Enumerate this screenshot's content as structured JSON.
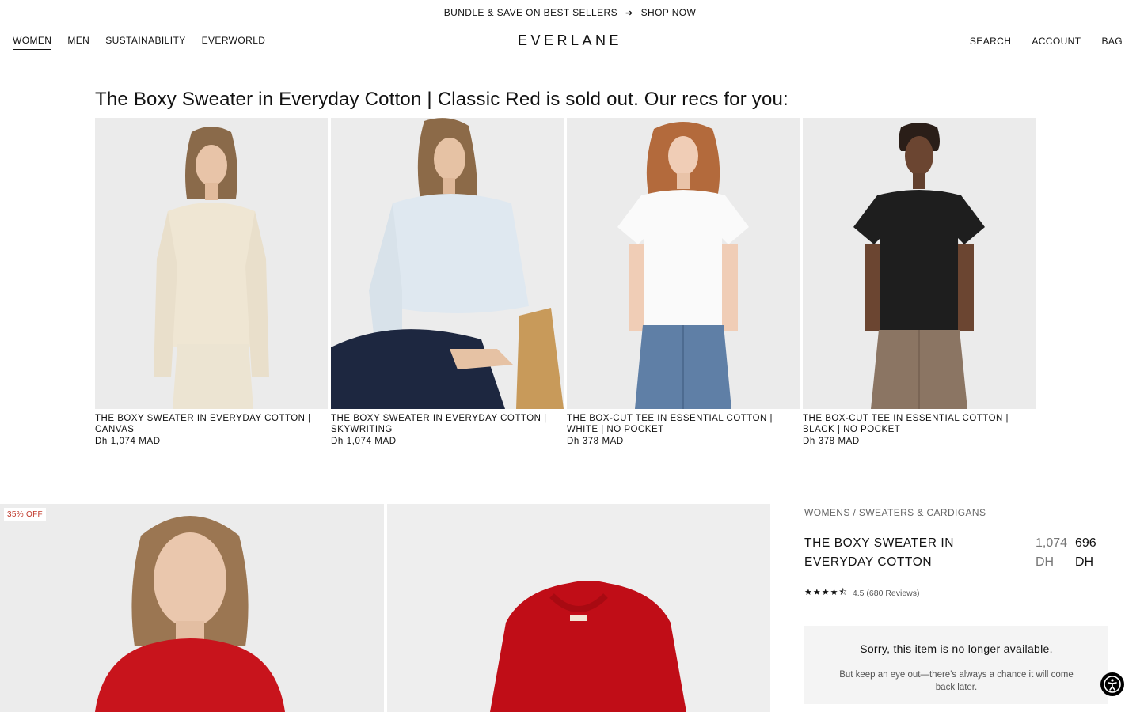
{
  "promo": {
    "text": "BUNDLE & SAVE ON BEST SELLERS",
    "link": "SHOP NOW"
  },
  "header": {
    "left_nav": [
      "WOMEN",
      "MEN",
      "SUSTAINABILITY",
      "EVERWORLD"
    ],
    "logo": "EVERLANE",
    "right_nav": [
      "SEARCH",
      "ACCOUNT",
      "BAG"
    ]
  },
  "recs": {
    "title": "The Boxy Sweater in Everyday Cotton | Classic Red is sold out. Our recs for you:",
    "items": [
      {
        "name": "THE BOXY SWEATER IN EVERYDAY COTTON | CANVAS",
        "price": "Dh 1,074 MAD",
        "garment_color": "#efe6d3"
      },
      {
        "name": "THE BOXY SWEATER IN EVERYDAY COTTON | SKYWRITING",
        "price": "Dh 1,074 MAD",
        "garment_color": "#dfe8f0"
      },
      {
        "name": "THE BOX-CUT TEE IN ESSENTIAL COTTON | WHITE | NO POCKET",
        "price": "Dh 378 MAD",
        "garment_color": "#fafafa"
      },
      {
        "name": "THE BOX-CUT TEE IN ESSENTIAL COTTON | BLACK | NO POCKET",
        "price": "Dh 378 MAD",
        "garment_color": "#1e1e1e"
      }
    ]
  },
  "product": {
    "badge": "35% OFF",
    "breadcrumb": "WOMENS / SWEATERS & CARDIGANS",
    "title": "THE BOXY SWEATER IN EVERYDAY COTTON",
    "old_price": "1,074 DH",
    "new_price": "696 DH",
    "rating_value": 4.5,
    "rating_text": "4.5 (680 Reviews)",
    "sold_out_title": "Sorry, this item is no longer available.",
    "sold_out_text": "But keep an eye out—there's always a chance it will come back later.",
    "color": "#c8141c"
  },
  "icons": {
    "arrow": "arrow-right-icon",
    "star": "star-icon",
    "accessibility": "accessibility-icon"
  }
}
